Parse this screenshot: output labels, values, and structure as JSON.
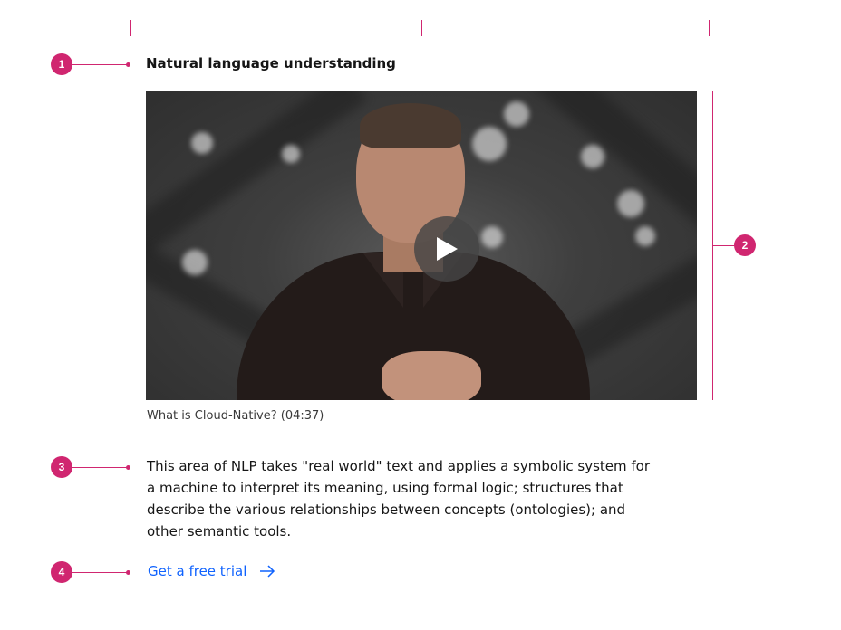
{
  "component": {
    "title": "Natural language understanding",
    "video": {
      "caption": "What is Cloud-Native? (04:37)",
      "play_icon": "play-icon"
    },
    "body": "This area of NLP takes \"real world\" text and applies a symbolic system for a machine to interpret its meaning, using formal logic; structures that describe the various relationships between concepts (ontologies); and other semantic tools.",
    "cta": {
      "label": "Get a free trial",
      "icon": "arrow-right-icon"
    }
  },
  "annotations": {
    "markers": [
      "1",
      "2",
      "3",
      "4"
    ],
    "color": "#d02670"
  },
  "colors": {
    "link": "#0f62fe",
    "text": "#161616",
    "caption": "#393939"
  }
}
